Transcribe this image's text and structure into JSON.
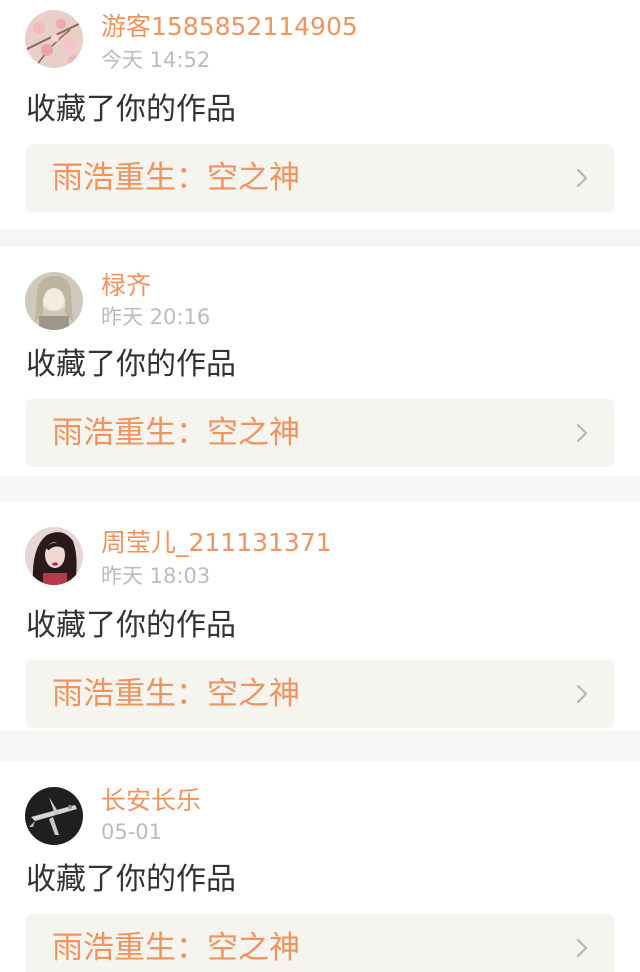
{
  "notifications": [
    {
      "username": "游客1585852114905",
      "time": "今天 14:52",
      "action": "收藏了你的作品",
      "work_title": "雨浩重生：空之神",
      "avatar_icon": "blossom-avatar-icon"
    },
    {
      "username": "椂齐",
      "time": "昨天 20:16",
      "action": "收藏了你的作品",
      "work_title": "雨浩重生：空之神",
      "avatar_icon": "anime-girl-avatar-icon"
    },
    {
      "username": "周莹儿_211131371",
      "time": "昨天 18:03",
      "action": "收藏了你的作品",
      "work_title": "雨浩重生：空之神",
      "avatar_icon": "dark-hair-avatar-icon"
    },
    {
      "username": "长安长乐",
      "time": "05-01",
      "action": "收藏了你的作品",
      "work_title": "雨浩重生：空之神",
      "avatar_icon": "aircraft-avatar-icon"
    }
  ],
  "colors": {
    "accent": "#f0945f",
    "timestamp": "#bcbcbc",
    "action_text": "#333333",
    "link_bg": "#f5f4ee",
    "separator": "#f6f6f6"
  }
}
